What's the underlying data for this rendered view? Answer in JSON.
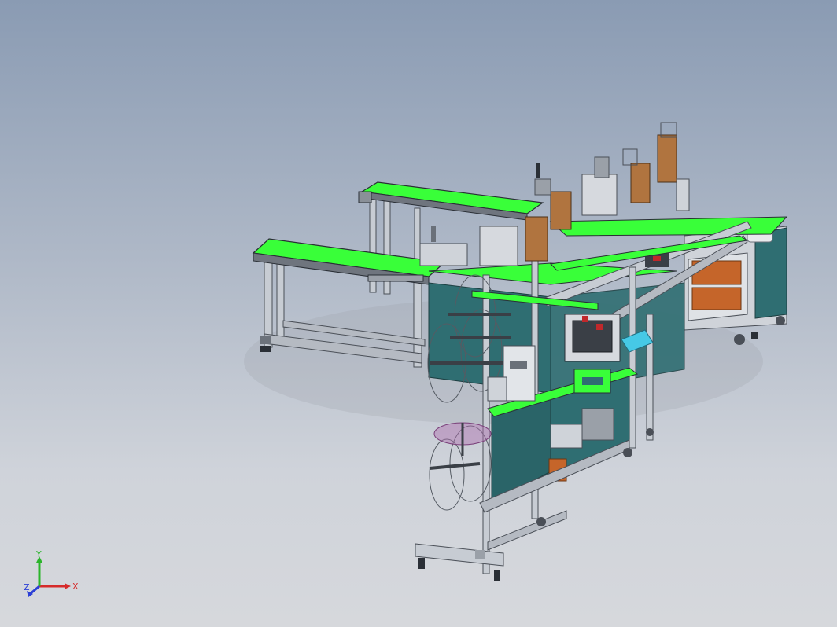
{
  "viewport": {
    "background_top": "#8a9bb3",
    "background_bottom": "#d6d8dc"
  },
  "colors": {
    "conveyor_belt": "#39ff39",
    "frame_aluminum": "#b9bec6",
    "frame_dark": "#4a4f57",
    "cabinet_panel": "#2f6e72",
    "copper_parts": "#b0743f",
    "orange_box": "#c5652a",
    "cyan_part": "#46c9e6",
    "magenta_spool": "#b06fb0"
  },
  "triad": {
    "x_label": "X",
    "y_label": "Y",
    "z_label": "Z",
    "x_color": "#d62b2b",
    "y_color": "#2bb52b",
    "z_color": "#2b3fd6"
  }
}
